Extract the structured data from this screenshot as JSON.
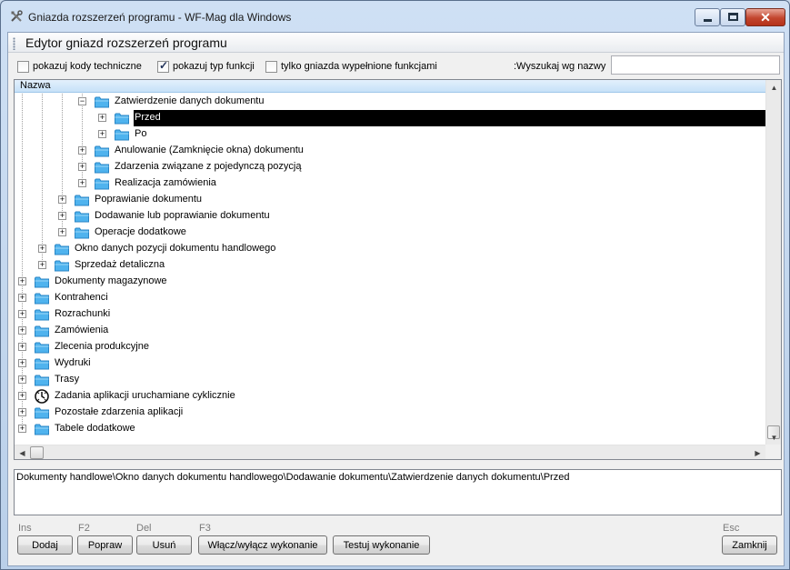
{
  "window": {
    "title": "Gniazda rozszerzeń programu - WF-Mag dla Windows",
    "close_glyph": "✕"
  },
  "editor": {
    "title": "Edytor gniazd rozszerzeń programu"
  },
  "options": {
    "show_tech_codes": {
      "label": "pokazuj kody techniczne",
      "checked": false
    },
    "show_function_type": {
      "label": "pokazuj typ funkcji",
      "checked": true
    },
    "only_filled": {
      "label": "tylko gniazda wypełnione funkcjami",
      "checked": false
    }
  },
  "search": {
    "label": ":Wyszukaj wg nazwy",
    "value": ""
  },
  "tree": {
    "column_header": "Nazwa",
    "rows": [
      {
        "label": "Zatwierdzenie danych dokumentu",
        "level": 3,
        "expander": "−",
        "selected": false
      },
      {
        "label": "Przed",
        "level": 4,
        "expander": "+",
        "selected": true
      },
      {
        "label": "Po",
        "level": 4,
        "expander": "+",
        "selected": false
      },
      {
        "label": "Anulowanie (Zamknięcie okna) dokumentu",
        "level": 3,
        "expander": "+",
        "selected": false
      },
      {
        "label": "Zdarzenia związane z pojedynczą pozycją",
        "level": 3,
        "expander": "+",
        "selected": false
      },
      {
        "label": "Realizacja zamówienia",
        "level": 3,
        "expander": "+",
        "selected": false
      },
      {
        "label": "Poprawianie dokumentu",
        "level": 2,
        "expander": "+",
        "selected": false
      },
      {
        "label": "Dodawanie lub poprawianie dokumentu",
        "level": 2,
        "expander": "+",
        "selected": false
      },
      {
        "label": "Operacje dodatkowe",
        "level": 2,
        "expander": "+",
        "selected": false
      },
      {
        "label": "Okno danych pozycji dokumentu handlowego",
        "level": 1,
        "expander": "+",
        "selected": false
      },
      {
        "label": "Sprzedaż detaliczna",
        "level": 1,
        "expander": "+",
        "selected": false
      },
      {
        "label": "Dokumenty magazynowe",
        "level": 0,
        "expander": "+",
        "selected": false
      },
      {
        "label": "Kontrahenci",
        "level": 0,
        "expander": "+",
        "selected": false
      },
      {
        "label": "Rozrachunki",
        "level": 0,
        "expander": "+",
        "selected": false
      },
      {
        "label": "Zamówienia",
        "level": 0,
        "expander": "+",
        "selected": false
      },
      {
        "label": "Zlecenia produkcyjne",
        "level": 0,
        "expander": "+",
        "selected": false
      },
      {
        "label": "Wydruki",
        "level": 0,
        "expander": "+",
        "selected": false
      },
      {
        "label": "Trasy",
        "level": 0,
        "expander": "+",
        "selected": false
      },
      {
        "label": "Zadania aplikacji uruchamiane cyklicznie",
        "level": 0,
        "expander": "+",
        "selected": false,
        "icon": "clock-icon"
      },
      {
        "label": "Pozostałe zdarzenia aplikacji",
        "level": 0,
        "expander": "+",
        "selected": false
      },
      {
        "label": "Tabele dodatkowe",
        "level": 0,
        "expander": "+",
        "selected": false
      }
    ]
  },
  "path": {
    "text": "Dokumenty handlowe\\Okno danych dokumentu handlowego\\Dodawanie dokumentu\\Zatwierdzenie danych dokumentu\\Przed"
  },
  "buttons": {
    "add": {
      "key": "Ins",
      "label": "Dodaj"
    },
    "edit": {
      "key": "F2",
      "label": "Popraw"
    },
    "delete": {
      "key": "Del",
      "label": "Usuń"
    },
    "toggle": {
      "key": "F3",
      "label": "Włącz/wyłącz wykonanie"
    },
    "test": {
      "label": "Testuj wykonanie"
    },
    "close": {
      "key": "Esc",
      "label": "Zamknij"
    }
  },
  "icons": {
    "folder": "folder-icon",
    "clock": "clock-icon",
    "app": "tools-icon"
  },
  "colors": {
    "folder": "#4fb3ee",
    "selection": "#000000",
    "header": "#c6e1f8"
  }
}
